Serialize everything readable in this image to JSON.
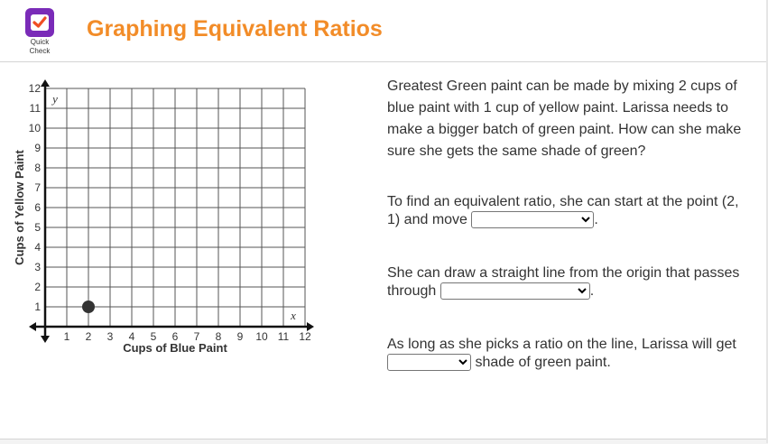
{
  "header": {
    "logo_text": "Quick Check",
    "title": "Graphing Equivalent Ratios"
  },
  "question": {
    "intro": "Greatest Green paint can be made by mixing 2 cups of blue paint with 1 cup of yellow paint. Larissa needs to make a bigger batch of green paint. How can she make sure she gets the same shade of green?",
    "part1_before": "To find an equivalent ratio, she can start at the point (2, 1) and move",
    "part1_after": ".",
    "part1_selected": "",
    "part2_before": "She can draw a straight line from the origin that passes through",
    "part2_after": ".",
    "part2_selected": "",
    "part3_before": "",
    "part3_after": "shade of green paint.",
    "part3_lead": "As long as she picks a ratio on the line, Larissa will get",
    "part3_selected": ""
  },
  "chart_data": {
    "type": "scatter",
    "xlabel": "Cups of Blue Paint",
    "ylabel": "Cups of Yellow Paint",
    "x_axis_letter": "x",
    "y_axis_letter": "y",
    "xlim": [
      0,
      12
    ],
    "ylim": [
      0,
      12
    ],
    "x_ticks": [
      "1",
      "2",
      "3",
      "4",
      "5",
      "6",
      "7",
      "8",
      "9",
      "10",
      "11",
      "12"
    ],
    "y_ticks": [
      "1",
      "2",
      "3",
      "4",
      "5",
      "6",
      "7",
      "8",
      "9",
      "10",
      "11",
      "12"
    ],
    "grid": true,
    "points": [
      {
        "x": 2,
        "y": 1
      }
    ]
  },
  "colors": {
    "title": "#f28c28",
    "logo_bg": "#7a2bb8",
    "logo_check": "#f04e23"
  }
}
